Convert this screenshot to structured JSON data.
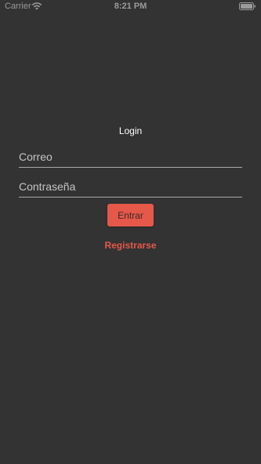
{
  "status_bar": {
    "carrier": "Carrier",
    "time": "8:21 PM",
    "icons": [
      "wifi-icon",
      "battery-icon"
    ]
  },
  "login": {
    "title": "Login",
    "email_placeholder": "Correo",
    "password_placeholder": "Contraseña",
    "submit_label": "Entrar",
    "register_label": "Registrarse"
  },
  "colors": {
    "background": "#333333",
    "accent": "#e5584a",
    "status_text": "#9a9a9a"
  }
}
